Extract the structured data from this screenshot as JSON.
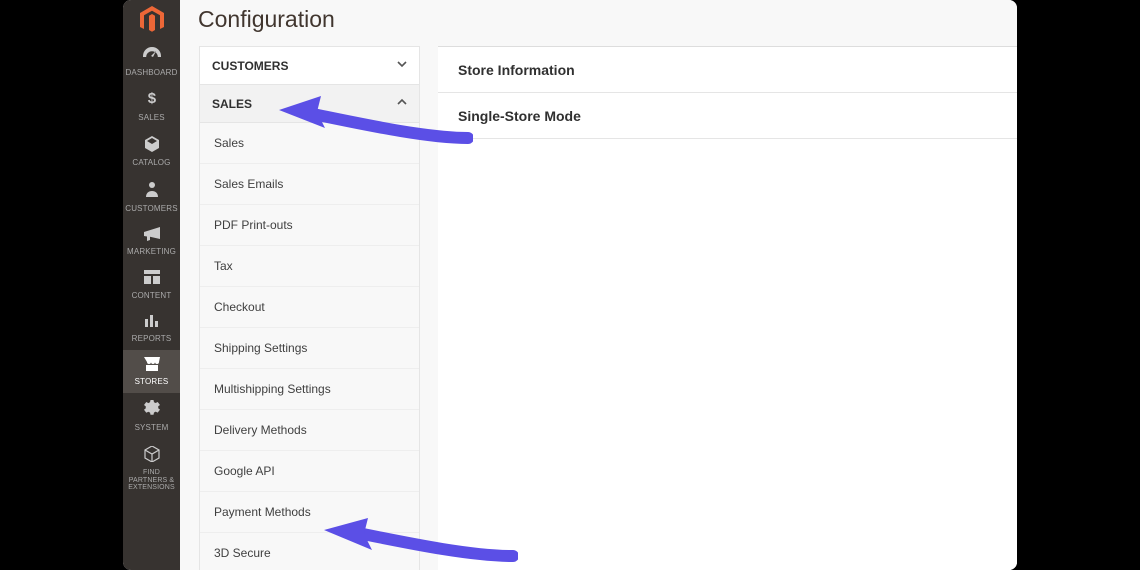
{
  "page": {
    "title": "Configuration"
  },
  "nav": {
    "items": [
      {
        "label": "DASHBOARD"
      },
      {
        "label": "SALES"
      },
      {
        "label": "CATALOG"
      },
      {
        "label": "CUSTOMERS"
      },
      {
        "label": "MARKETING"
      },
      {
        "label": "CONTENT"
      },
      {
        "label": "REPORTS"
      },
      {
        "label": "STORES"
      },
      {
        "label": "SYSTEM"
      },
      {
        "label": "FIND PARTNERS & EXTENSIONS"
      }
    ]
  },
  "tabs": {
    "customers": {
      "label": "CUSTOMERS"
    },
    "sales": {
      "label": "SALES",
      "items": [
        "Sales",
        "Sales Emails",
        "PDF Print-outs",
        "Tax",
        "Checkout",
        "Shipping Settings",
        "Multishipping Settings",
        "Delivery Methods",
        "Google API",
        "Payment Methods",
        "3D Secure"
      ]
    }
  },
  "content": {
    "sections": [
      "Store Information",
      "Single-Store Mode"
    ]
  },
  "colors": {
    "arrow": "#5b4fe6"
  }
}
